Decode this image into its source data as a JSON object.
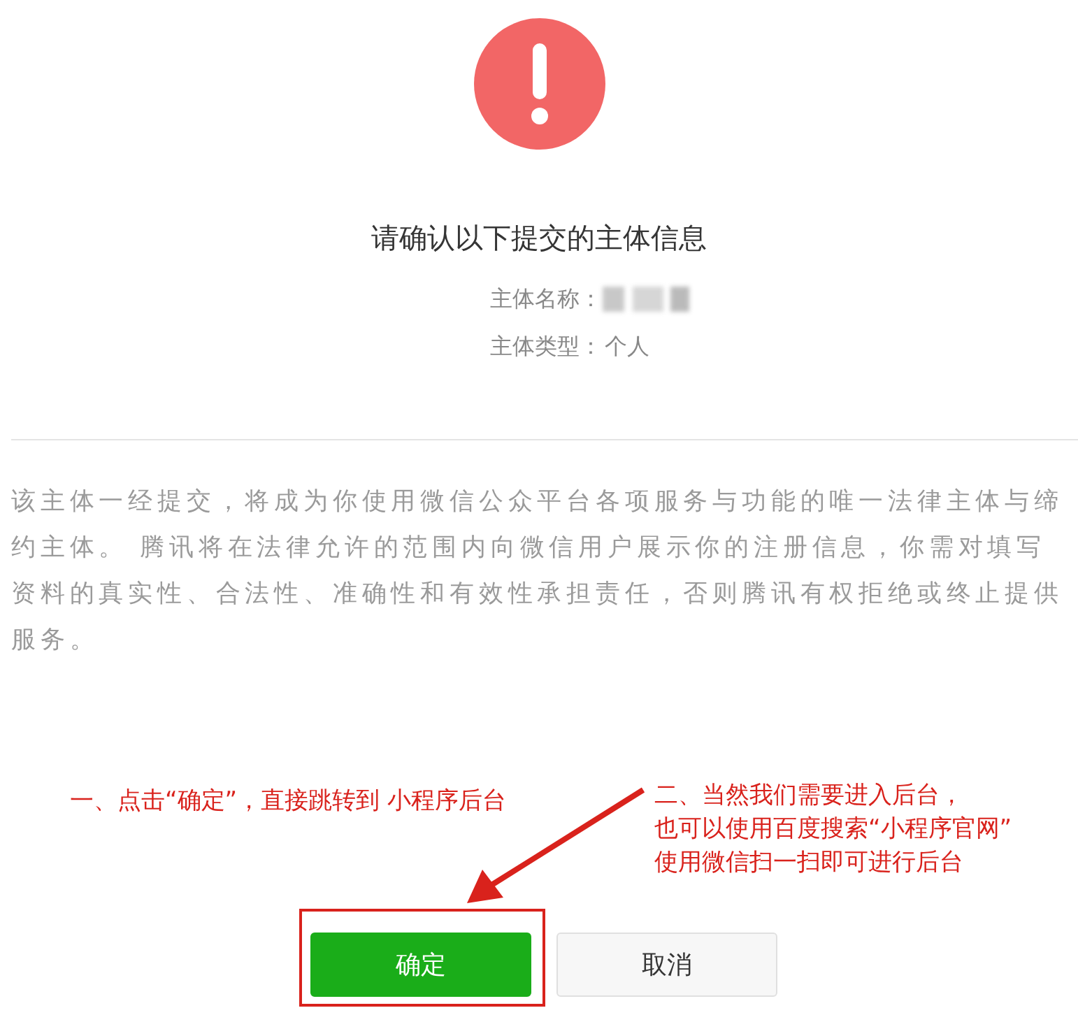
{
  "dialog": {
    "title": "请确认以下提交的主体信息",
    "fields": [
      {
        "label": "主体名称：",
        "redacted": true
      },
      {
        "label": "主体类型：",
        "value": "个人",
        "redacted": false
      }
    ],
    "notice": "该主体一经提交，将成为你使用微信公众平台各项服务与功能的唯一法律主体与缔约主体。 腾讯将在法律允许的范围内向微信用户展示你的注册信息，你需对填写资料的真实性、合法性、准确性和有效性承担责任，否则腾讯有权拒绝或终止提供服务。",
    "buttons": [
      {
        "label": "确定",
        "kind": "primary",
        "highlighted": true
      },
      {
        "label": "取消",
        "kind": "default",
        "highlighted": false
      }
    ]
  },
  "annotations": [
    {
      "lines": [
        "一、点击“确定”，直接跳转到  小程序后台"
      ]
    },
    {
      "lines": [
        "二、当然我们需要进入后台，",
        "也可以使用百度搜索“小程序官网”",
        "使用微信扫一扫即可进行后台"
      ]
    }
  ]
}
